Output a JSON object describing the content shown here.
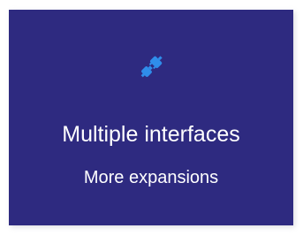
{
  "card": {
    "title": "Multiple interfaces",
    "subtitle": "More expansions",
    "icon": "plug-icon",
    "background_color": "#2e2a80",
    "icon_color": "#2f8dea"
  }
}
